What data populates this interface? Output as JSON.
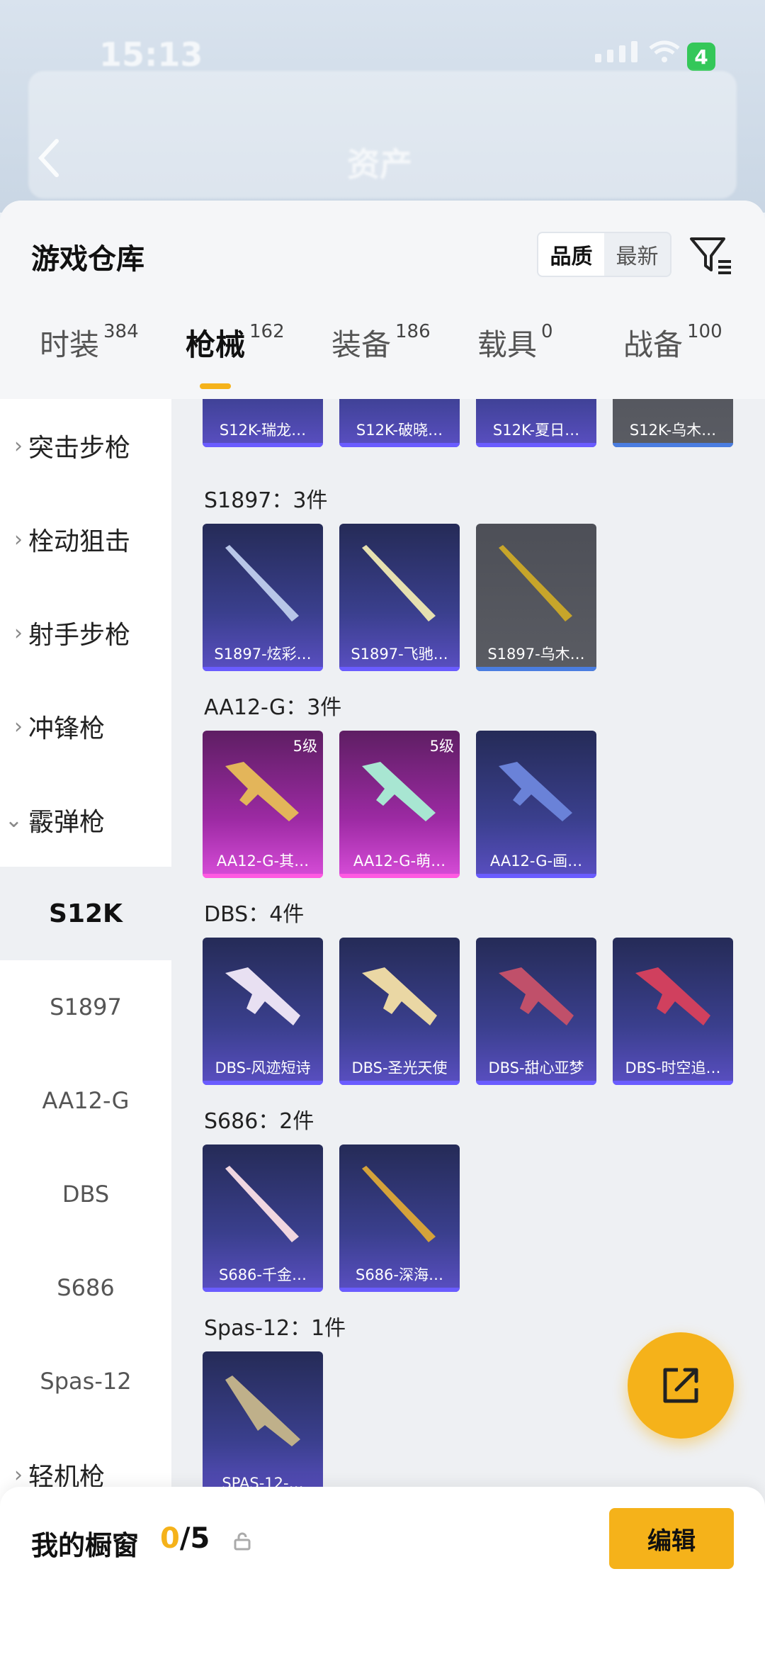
{
  "status": {
    "time": "15:13",
    "battery": "4"
  },
  "nav": {
    "title": "资产"
  },
  "sheet": {
    "title": "游戏仓库",
    "sort": [
      "品质",
      "最新"
    ]
  },
  "tabs": [
    {
      "label": "时装",
      "count": "384"
    },
    {
      "label": "枪械",
      "count": "162"
    },
    {
      "label": "装备",
      "count": "186"
    },
    {
      "label": "载具",
      "count": "0"
    },
    {
      "label": "战备",
      "count": "100"
    }
  ],
  "categories": {
    "assault": "突击步枪",
    "bolt": "栓动狙击",
    "marksman": "射手步枪",
    "smg": "冲锋枪",
    "shotgun": "霰弹枪",
    "lmg": "轻机枪",
    "shotgun_sub": [
      "S12K",
      "S1897",
      "AA12-G",
      "DBS",
      "S686",
      "Spas-12"
    ]
  },
  "groups": {
    "s12k": {
      "items": [
        "S12K-瑞龙…",
        "S12K-破晓…",
        "S12K-夏日…",
        "S12K-乌木…"
      ]
    },
    "s1897": {
      "title": "S1897：3件",
      "items": [
        "S1897-炫彩…",
        "S1897-飞驰…",
        "S1897-乌木…"
      ]
    },
    "aa12": {
      "title": "AA12-G：3件",
      "items": [
        "AA12-G-其…",
        "AA12-G-萌…",
        "AA12-G-画…"
      ],
      "level": "5级"
    },
    "dbs": {
      "title": "DBS：4件",
      "items": [
        "DBS-风迹短诗",
        "DBS-圣光天使",
        "DBS-甜心亚梦",
        "DBS-时空追…"
      ]
    },
    "s686": {
      "title": "S686：2件",
      "items": [
        "S686-千金…",
        "S686-深海…"
      ]
    },
    "spas": {
      "title": "Spas-12：1件",
      "items": [
        "SPAS-12-…"
      ]
    }
  },
  "showcase": {
    "title": "我的橱窗",
    "used": "0",
    "total": "/5",
    "edit_label": "编辑"
  },
  "colors": {
    "accent": "#f5b21a",
    "card_blue": "#3a3f8d",
    "card_pink": "#9c2aa3",
    "card_gray": "#5a5c63"
  }
}
